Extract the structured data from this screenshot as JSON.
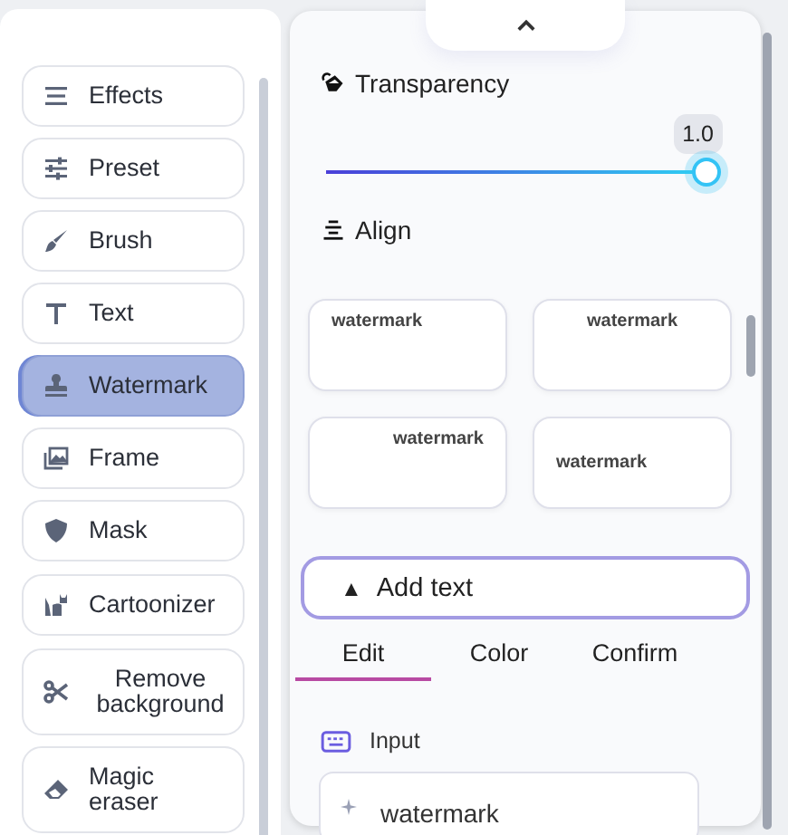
{
  "tools": [
    {
      "label": "Effects",
      "selected": false
    },
    {
      "label": "Preset",
      "selected": false
    },
    {
      "label": "Brush",
      "selected": false
    },
    {
      "label": "Text",
      "selected": false
    },
    {
      "label": "Watermark",
      "selected": true
    },
    {
      "label": "Frame",
      "selected": false
    },
    {
      "label": "Mask",
      "selected": false
    },
    {
      "label": "Cartoonizer",
      "selected": false
    },
    {
      "label": "Remove background",
      "selected": false
    },
    {
      "label": "Magic eraser",
      "selected": false
    }
  ],
  "transparency": {
    "label": "Transparency",
    "level": 1.0,
    "reading": "1.0"
  },
  "align": {
    "label": "Align"
  },
  "templates": [
    {
      "text": "watermark",
      "kind": "top-left"
    },
    {
      "text": "watermark",
      "kind": "top-center"
    },
    {
      "text": "watermark",
      "kind": "top-right"
    },
    {
      "text": "watermark",
      "kind": "middle-left"
    }
  ],
  "add_text": {
    "icon": "▲",
    "label": "Add text"
  },
  "tabs": [
    {
      "label": "Edit",
      "selected": true
    },
    {
      "label": "Color",
      "selected": false
    },
    {
      "label": "Confirm",
      "selected": false
    }
  ],
  "input": {
    "label": "Input",
    "value": "watermark"
  }
}
